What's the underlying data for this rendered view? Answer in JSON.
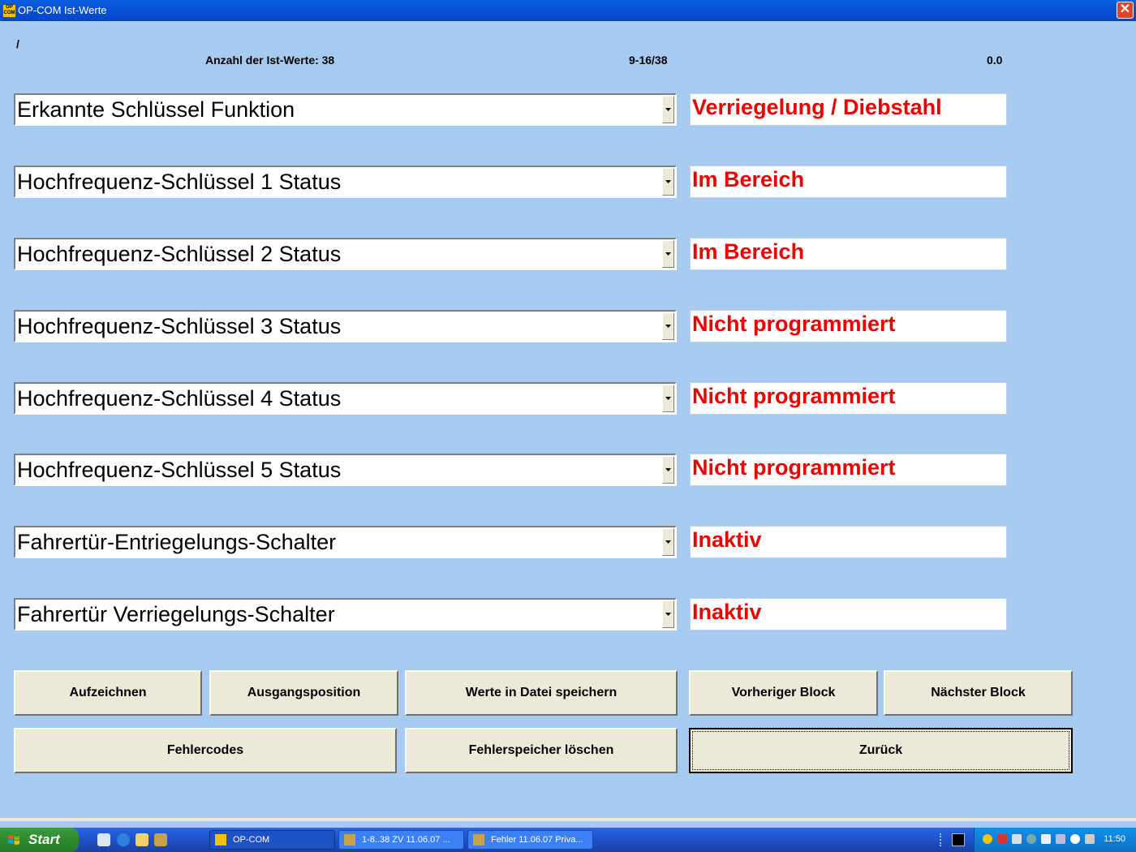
{
  "window": {
    "title": "OP-COM Ist-Werte",
    "app_icon_text": "OP COM",
    "close_label": "✕"
  },
  "header": {
    "path": "/",
    "count_label": "Anzahl der Ist-Werte: 38",
    "range": "9-16/38",
    "time_value": "0.0"
  },
  "rows": [
    {
      "label": "Erkannte Schlüssel Funktion",
      "value": "Verriegelung / Diebstahl"
    },
    {
      "label": "Hochfrequenz-Schlüssel 1 Status",
      "value": "Im Bereich"
    },
    {
      "label": "Hochfrequenz-Schlüssel 2 Status",
      "value": "Im Bereich"
    },
    {
      "label": "Hochfrequenz-Schlüssel 3 Status",
      "value": "Nicht programmiert"
    },
    {
      "label": "Hochfrequenz-Schlüssel 4 Status",
      "value": "Nicht programmiert"
    },
    {
      "label": "Hochfrequenz-Schlüssel 5 Status",
      "value": "Nicht programmiert"
    },
    {
      "label": "Fahrertür-Entriegelungs-Schalter",
      "value": "Inaktiv"
    },
    {
      "label": "Fahrertür Verriegelungs-Schalter",
      "value": "Inaktiv"
    }
  ],
  "buttons": {
    "record": "Aufzeichnen",
    "home": "Ausgangsposition",
    "save_values": "Werte in Datei speichern",
    "prev_block": "Vorheriger Block",
    "next_block": "Nächster Block",
    "fault_codes": "Fehlercodes",
    "clear_faults": "Fehlerspeicher löschen",
    "back": "Zurück"
  },
  "taskbar": {
    "start_label": "Start",
    "tasks": [
      {
        "label": "OP-COM",
        "active": true
      },
      {
        "label": "1-8..38 ZV 11.06.07 ...",
        "active": false
      },
      {
        "label": "Fehler 11.06.07 Priva...",
        "active": false
      }
    ],
    "clock": "11:50"
  },
  "colors": {
    "background": "#a6caf0",
    "value_text": "#ee0000",
    "button_face": "#ece9d8"
  }
}
